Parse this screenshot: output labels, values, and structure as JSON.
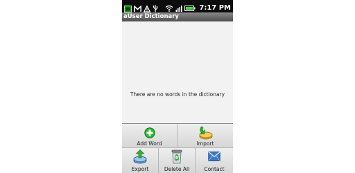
{
  "status_bar": {
    "time": "7:17 PM"
  },
  "app": {
    "title": "aUser Dictionary"
  },
  "content": {
    "empty_message": "There are no words in the dictionary"
  },
  "menu": {
    "add_word": "Add Word",
    "import": "Import",
    "export": "Export",
    "delete_all": "Delete All",
    "contact": "Contact"
  }
}
